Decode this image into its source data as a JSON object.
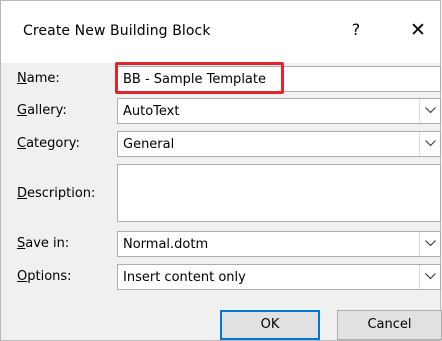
{
  "dialog": {
    "title": "Create New Building Block",
    "help_glyph": "?",
    "close_glyph": "✕"
  },
  "fields": {
    "name": {
      "label_key": "N",
      "label_rest": "ame:",
      "value": "BB - Sample Template"
    },
    "gallery": {
      "label_key": "G",
      "label_rest": "allery:",
      "value": "AutoText"
    },
    "category": {
      "label_key": "C",
      "label_rest": "ategory:",
      "value": "General"
    },
    "description": {
      "label_key": "D",
      "label_rest": "escription:",
      "value": ""
    },
    "save_in": {
      "label_key": "S",
      "label_rest": "ave in:",
      "value": "Normal.dotm"
    },
    "options": {
      "label_key": "O",
      "label_rest": "ptions:",
      "value": "Insert content only"
    }
  },
  "buttons": {
    "ok": "OK",
    "cancel": "Cancel"
  },
  "colors": {
    "highlight": "#e3262d",
    "default_button_border": "#0078d7"
  }
}
